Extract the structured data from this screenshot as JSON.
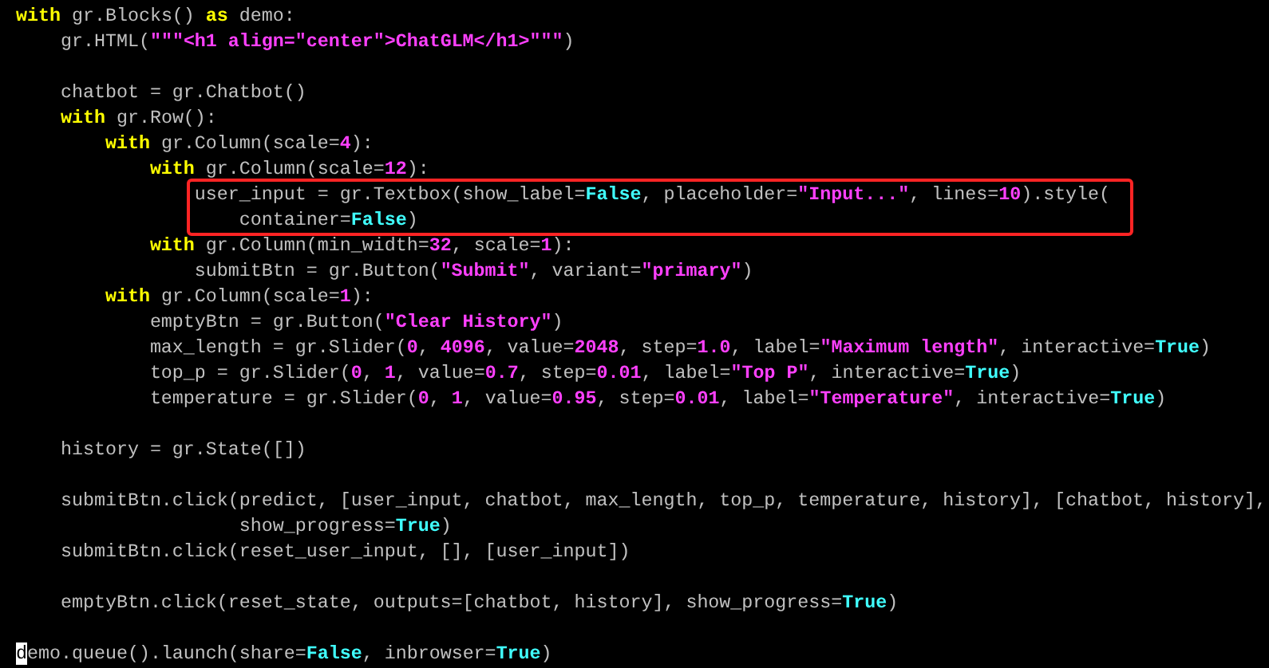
{
  "editor": {
    "segments": [
      {
        "boxed": false,
        "lines": [
          {
            "kind": "code",
            "tokens": [
              {
                "kind": "keyword",
                "text": "with"
              },
              {
                "kind": "plain",
                "text": " gr.Blocks() "
              },
              {
                "kind": "keyword",
                "text": "as"
              },
              {
                "kind": "plain",
                "text": " demo:"
              }
            ]
          },
          {
            "kind": "code",
            "tokens": [
              {
                "kind": "plain",
                "text": "    gr.HTML("
              },
              {
                "kind": "string",
                "text": "\"\"\"<h1 align=\"center\">ChatGLM</h1>\"\"\""
              },
              {
                "kind": "plain",
                "text": ")"
              }
            ]
          },
          {
            "kind": "blank"
          },
          {
            "kind": "code",
            "tokens": [
              {
                "kind": "plain",
                "text": "    chatbot = gr.Chatbot()"
              }
            ]
          },
          {
            "kind": "code",
            "tokens": [
              {
                "kind": "keyword",
                "text": "    with"
              },
              {
                "kind": "plain",
                "text": " gr.Row():"
              }
            ]
          },
          {
            "kind": "code",
            "tokens": [
              {
                "kind": "keyword",
                "text": "        with"
              },
              {
                "kind": "plain",
                "text": " gr.Column(scale="
              },
              {
                "kind": "number",
                "text": "4"
              },
              {
                "kind": "plain",
                "text": "):"
              }
            ]
          },
          {
            "kind": "code",
            "tokens": [
              {
                "kind": "keyword",
                "text": "            with"
              },
              {
                "kind": "plain",
                "text": " gr.Column(scale="
              },
              {
                "kind": "number",
                "text": "12"
              },
              {
                "kind": "plain",
                "text": "):"
              }
            ]
          }
        ]
      },
      {
        "boxed": true,
        "lines": [
          {
            "kind": "code",
            "tokens": [
              {
                "kind": "plain",
                "text": "                user_input = gr.Textbox(show_label="
              },
              {
                "kind": "constant",
                "text": "False"
              },
              {
                "kind": "plain",
                "text": ", placeholder="
              },
              {
                "kind": "string",
                "text": "\"Input...\""
              },
              {
                "kind": "plain",
                "text": ", lines="
              },
              {
                "kind": "number",
                "text": "10"
              },
              {
                "kind": "plain",
                "text": ").style("
              }
            ]
          },
          {
            "kind": "code",
            "tokens": [
              {
                "kind": "plain",
                "text": "                    container="
              },
              {
                "kind": "constant",
                "text": "False"
              },
              {
                "kind": "plain",
                "text": ")"
              }
            ]
          }
        ]
      },
      {
        "boxed": false,
        "lines": [
          {
            "kind": "code",
            "tokens": [
              {
                "kind": "keyword",
                "text": "            with"
              },
              {
                "kind": "plain",
                "text": " gr.Column(min_width="
              },
              {
                "kind": "number",
                "text": "32"
              },
              {
                "kind": "plain",
                "text": ", scale="
              },
              {
                "kind": "number",
                "text": "1"
              },
              {
                "kind": "plain",
                "text": "):"
              }
            ]
          },
          {
            "kind": "code",
            "tokens": [
              {
                "kind": "plain",
                "text": "                submitBtn = gr.Button("
              },
              {
                "kind": "string",
                "text": "\"Submit\""
              },
              {
                "kind": "plain",
                "text": ", variant="
              },
              {
                "kind": "string",
                "text": "\"primary\""
              },
              {
                "kind": "plain",
                "text": ")"
              }
            ]
          },
          {
            "kind": "code",
            "tokens": [
              {
                "kind": "keyword",
                "text": "        with"
              },
              {
                "kind": "plain",
                "text": " gr.Column(scale="
              },
              {
                "kind": "number",
                "text": "1"
              },
              {
                "kind": "plain",
                "text": "):"
              }
            ]
          },
          {
            "kind": "code",
            "tokens": [
              {
                "kind": "plain",
                "text": "            emptyBtn = gr.Button("
              },
              {
                "kind": "string",
                "text": "\"Clear History\""
              },
              {
                "kind": "plain",
                "text": ")"
              }
            ]
          },
          {
            "kind": "code",
            "tokens": [
              {
                "kind": "plain",
                "text": "            max_length = gr.Slider("
              },
              {
                "kind": "number",
                "text": "0"
              },
              {
                "kind": "plain",
                "text": ", "
              },
              {
                "kind": "number",
                "text": "4096"
              },
              {
                "kind": "plain",
                "text": ", value="
              },
              {
                "kind": "number",
                "text": "2048"
              },
              {
                "kind": "plain",
                "text": ", step="
              },
              {
                "kind": "number",
                "text": "1.0"
              },
              {
                "kind": "plain",
                "text": ", label="
              },
              {
                "kind": "string",
                "text": "\"Maximum length\""
              },
              {
                "kind": "plain",
                "text": ", interactive="
              },
              {
                "kind": "constant",
                "text": "True"
              },
              {
                "kind": "plain",
                "text": ")"
              }
            ]
          },
          {
            "kind": "code",
            "tokens": [
              {
                "kind": "plain",
                "text": "            top_p = gr.Slider("
              },
              {
                "kind": "number",
                "text": "0"
              },
              {
                "kind": "plain",
                "text": ", "
              },
              {
                "kind": "number",
                "text": "1"
              },
              {
                "kind": "plain",
                "text": ", value="
              },
              {
                "kind": "number",
                "text": "0.7"
              },
              {
                "kind": "plain",
                "text": ", step="
              },
              {
                "kind": "number",
                "text": "0.01"
              },
              {
                "kind": "plain",
                "text": ", label="
              },
              {
                "kind": "string",
                "text": "\"Top P\""
              },
              {
                "kind": "plain",
                "text": ", interactive="
              },
              {
                "kind": "constant",
                "text": "True"
              },
              {
                "kind": "plain",
                "text": ")"
              }
            ]
          },
          {
            "kind": "code",
            "tokens": [
              {
                "kind": "plain",
                "text": "            temperature = gr.Slider("
              },
              {
                "kind": "number",
                "text": "0"
              },
              {
                "kind": "plain",
                "text": ", "
              },
              {
                "kind": "number",
                "text": "1"
              },
              {
                "kind": "plain",
                "text": ", value="
              },
              {
                "kind": "number",
                "text": "0.95"
              },
              {
                "kind": "plain",
                "text": ", step="
              },
              {
                "kind": "number",
                "text": "0.01"
              },
              {
                "kind": "plain",
                "text": ", label="
              },
              {
                "kind": "string",
                "text": "\"Temperature\""
              },
              {
                "kind": "plain",
                "text": ", interactive="
              },
              {
                "kind": "constant",
                "text": "True"
              },
              {
                "kind": "plain",
                "text": ")"
              }
            ]
          },
          {
            "kind": "blank"
          },
          {
            "kind": "code",
            "tokens": [
              {
                "kind": "plain",
                "text": "    history = gr.State([])"
              }
            ]
          },
          {
            "kind": "blank"
          },
          {
            "kind": "code",
            "tokens": [
              {
                "kind": "plain",
                "text": "    submitBtn.click(predict, [user_input, chatbot, max_length, top_p, temperature, history], [chatbot, history],"
              }
            ]
          },
          {
            "kind": "code",
            "tokens": [
              {
                "kind": "plain",
                "text": "                    show_progress="
              },
              {
                "kind": "constant",
                "text": "True"
              },
              {
                "kind": "plain",
                "text": ")"
              }
            ]
          },
          {
            "kind": "code",
            "tokens": [
              {
                "kind": "plain",
                "text": "    submitBtn.click(reset_user_input, [], [user_input])"
              }
            ]
          },
          {
            "kind": "blank"
          },
          {
            "kind": "code",
            "tokens": [
              {
                "kind": "plain",
                "text": "    emptyBtn.click(reset_state, outputs=[chatbot, history], show_progress="
              },
              {
                "kind": "constant",
                "text": "True"
              },
              {
                "kind": "plain",
                "text": ")"
              }
            ]
          },
          {
            "kind": "blank"
          },
          {
            "kind": "code",
            "tokens": [
              {
                "kind": "cursor",
                "text": "d"
              },
              {
                "kind": "plain",
                "text": "emo.queue().launch(share="
              },
              {
                "kind": "constant",
                "text": "False"
              },
              {
                "kind": "plain",
                "text": ", inbrowser="
              },
              {
                "kind": "constant",
                "text": "True"
              },
              {
                "kind": "plain",
                "text": ")"
              }
            ]
          }
        ]
      }
    ]
  }
}
